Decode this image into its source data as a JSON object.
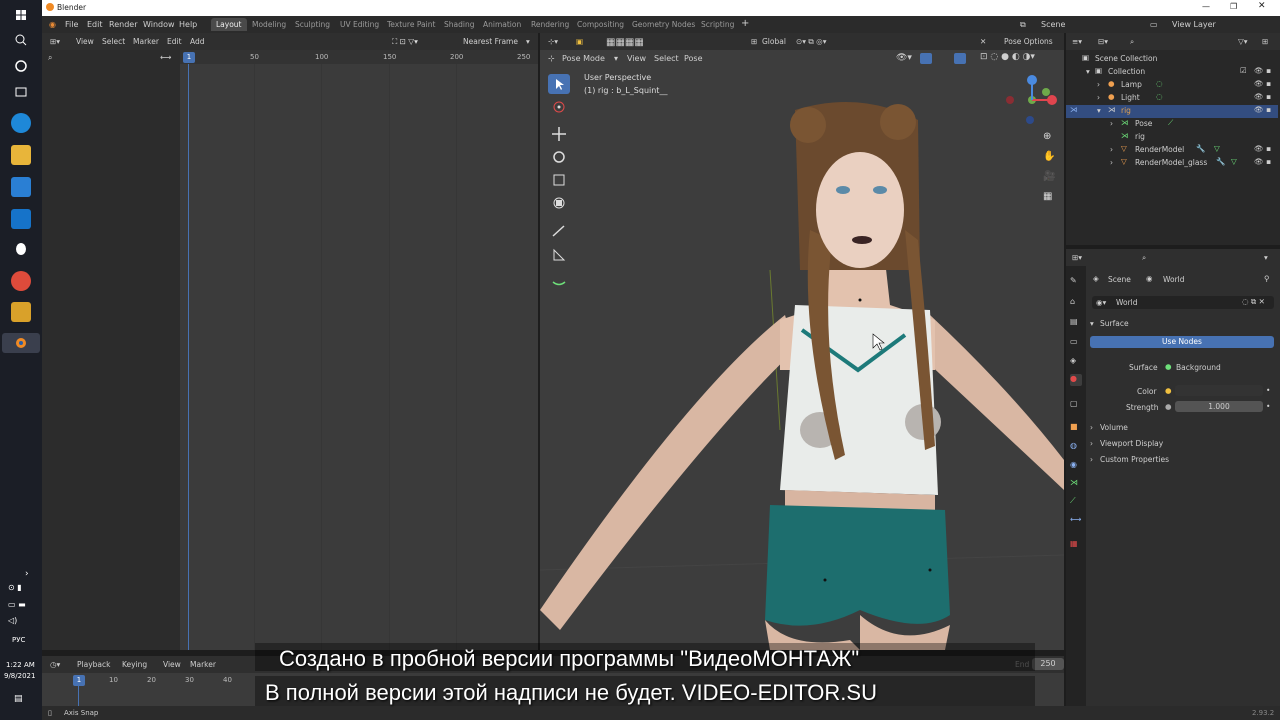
{
  "window": {
    "title": "Blender",
    "version": "2.93.2"
  },
  "menu": {
    "file": "File",
    "edit": "Edit",
    "render": "Render",
    "window": "Window",
    "help": "Help"
  },
  "workspaces": [
    "Layout",
    "Modeling",
    "Sculpting",
    "UV Editing",
    "Texture Paint",
    "Shading",
    "Animation",
    "Rendering",
    "Compositing",
    "Geometry Nodes",
    "Scripting"
  ],
  "scene_field": "Scene",
  "view_layer_field": "View Layer",
  "timeline_editor": {
    "menu": [
      "View",
      "Select",
      "Marker",
      "Edit",
      "Add"
    ],
    "snap_mode": "Nearest Frame",
    "current_frame": "1",
    "ruler": [
      "1",
      "50",
      "100",
      "150",
      "200",
      "250"
    ]
  },
  "viewport": {
    "mode": "Pose Mode",
    "menu": [
      "View",
      "Select",
      "Pose"
    ],
    "transform": "Global",
    "pose_options": "Pose Options",
    "overlay_title": "User Perspective",
    "overlay_sub": "(1) rig : b_L_Squint__"
  },
  "outliner": {
    "root": "Scene Collection",
    "items": [
      "Collection",
      "Lamp",
      "Light",
      "rig",
      "Pose",
      "rig",
      "RenderModel",
      "RenderModel_glass"
    ]
  },
  "properties": {
    "breadcrumb_scene": "Scene",
    "breadcrumb_world": "World",
    "world_name": "World",
    "section_surface": "Surface",
    "use_nodes": "Use Nodes",
    "surface_label": "Surface",
    "surface_value": "Background",
    "color_label": "Color",
    "strength_label": "Strength",
    "strength_value": "1.000",
    "sections": [
      "Volume",
      "Viewport Display",
      "Custom Properties"
    ]
  },
  "bottom_timeline": {
    "menu": [
      "Playback",
      "Keying",
      "View",
      "Marker"
    ],
    "current_frame": "1",
    "ruler": [
      "10",
      "20",
      "30",
      "40"
    ],
    "end_label": "End",
    "end_value": "250"
  },
  "status": {
    "axis_snap": "Axis Snap"
  },
  "system": {
    "time": "1:22 AM",
    "date": "9/8/2021",
    "lang": "РУС"
  },
  "watermark": {
    "line1": "Создано в пробной версии программы \"ВидеоМОНТАЖ\"",
    "line2": "В полной версии этой надписи не будет. VIDEO-EDITOR.SU"
  },
  "colors": {
    "accent": "#4772b3",
    "outliner_select": "#334d80",
    "viewport_bg": "#3d3d3d"
  }
}
